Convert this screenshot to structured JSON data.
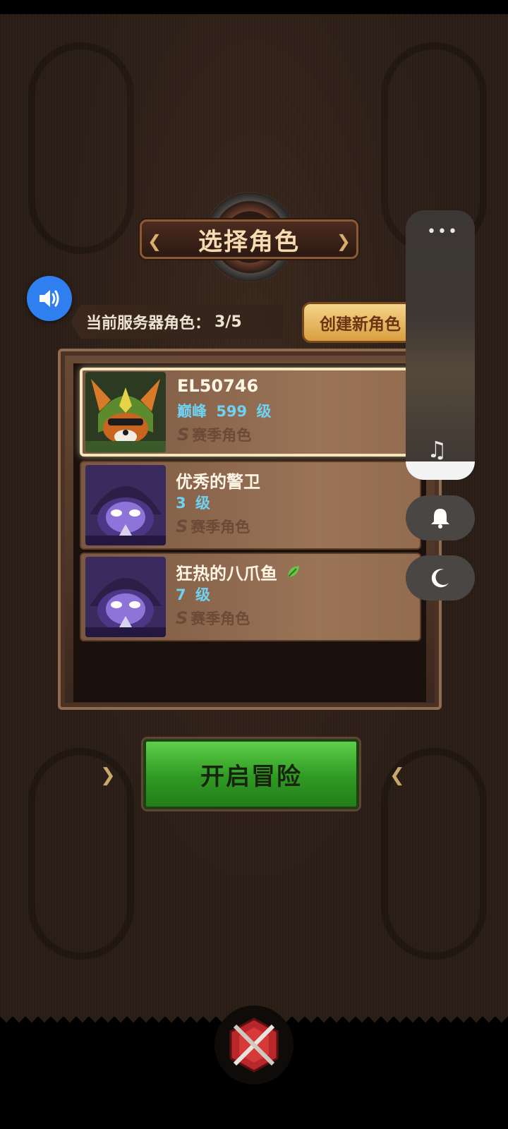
{
  "screen": {
    "title": "选择角色",
    "server_label": "当前服务器角色：",
    "server_count": "3/5",
    "create_button": "创建新角色",
    "start_button": "开启冒险"
  },
  "roles": [
    {
      "name": "EL50746",
      "level_prefix": "巅峰",
      "level": "599",
      "level_unit": "级",
      "season": "赛季角色",
      "selected": true,
      "avatar": "fox-archer-avatar"
    },
    {
      "name": "优秀的警卫",
      "level_prefix": "",
      "level": "3",
      "level_unit": "级",
      "season": "赛季角色",
      "selected": false,
      "avatar": "hooded-purple-mage-avatar"
    },
    {
      "name": "狂热的八爪鱼",
      "level_prefix": "",
      "level": "7",
      "level_unit": "级",
      "season": "赛季角色",
      "selected": false,
      "avatar": "hooded-purple-mage-avatar",
      "badge": "leaf-icon"
    }
  ],
  "icons": {
    "sound": "speaker-icon",
    "more": "more-dots-icon",
    "music": "music-note-icon",
    "bell": "bell-icon",
    "night": "moon-icon",
    "emblem": "crossed-swords-icon"
  },
  "colors": {
    "accent_blue": "#2f7ff0",
    "level_cyan": "#6ed2f2",
    "start_green": "#3aa82c",
    "create_gold": "#e8b45a"
  }
}
